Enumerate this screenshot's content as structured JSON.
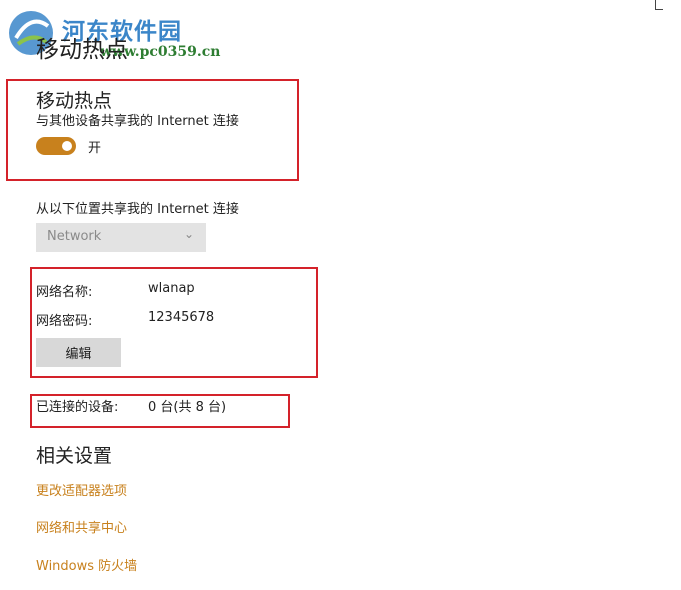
{
  "watermark": {
    "site_name": "河东软件园",
    "site_url": "www.pc0359.cn"
  },
  "page": {
    "title": "移动热点"
  },
  "hotspot": {
    "section_title": "移动热点",
    "description": "与其他设备共享我的 Internet 连接",
    "toggle_state_label": "开",
    "toggle_on": true
  },
  "share_from": {
    "label": "从以下位置共享我的 Internet 连接",
    "selected": "Network"
  },
  "network": {
    "name_label": "网络名称:",
    "name_value": "wlanap",
    "password_label": "网络密码:",
    "password_value": "12345678",
    "edit_label": "编辑"
  },
  "devices": {
    "label": "已连接的设备:",
    "value": "0 台(共 8 台)"
  },
  "related": {
    "title": "相关设置",
    "links": [
      "更改适配器选项",
      "网络和共享中心",
      "Windows 防火墙"
    ]
  },
  "colors": {
    "accent": "#c8811d",
    "highlight_box": "#d4222a",
    "watermark_blue": "#3b86c9"
  }
}
